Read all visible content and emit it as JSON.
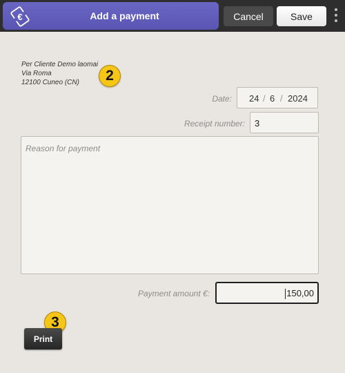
{
  "header": {
    "title": "Add a payment",
    "app_icon": "receipt-euro-icon",
    "cancel_label": "Cancel",
    "save_label": "Save",
    "menu_icon": "kebab-menu-icon",
    "accent_color": "#5f5bbd"
  },
  "address": {
    "line1": "Per Cliente Demo laomai",
    "line2": "Via Roma",
    "line3": "12100 Cuneo (CN)"
  },
  "annotations": {
    "badge_address": "2",
    "badge_print": "3"
  },
  "date": {
    "label": "Date:",
    "day": "24",
    "month": "6",
    "year": "2024",
    "separator": "/"
  },
  "receipt": {
    "label": "Receipt number:",
    "value": "3"
  },
  "reason": {
    "placeholder": "Reason for payment"
  },
  "amount": {
    "label": "Payment amount €:",
    "value": "150,00"
  },
  "footer": {
    "print_label": "Print"
  }
}
